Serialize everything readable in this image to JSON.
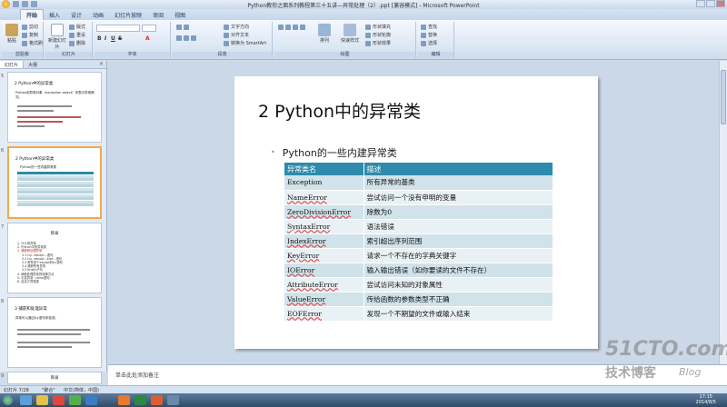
{
  "window": {
    "title": "Python教你之面系列教程第三十五讲—异常处理（2）.ppt [兼容模式] - Microsoft PowerPoint"
  },
  "ribbon": {
    "tabs": [
      "开始",
      "插入",
      "设计",
      "动画",
      "幻灯片放映",
      "审阅",
      "视图"
    ],
    "groups": {
      "clipboard": {
        "label": "剪贴板",
        "paste": "粘贴",
        "cut": "剪切",
        "copy": "复制",
        "format_painter": "格式刷"
      },
      "slides": {
        "label": "幻灯片",
        "new_slide": "新建幻灯片",
        "layout": "版式",
        "reset": "重设",
        "delete": "删除"
      },
      "font": {
        "label": "字体"
      },
      "paragraph": {
        "label": "段落",
        "text_direction": "文字方向",
        "align_text": "对齐文本",
        "convert_smartart": "转换为 SmartArt"
      },
      "drawing": {
        "label": "绘图",
        "arrange": "排列",
        "quick_styles": "快速样式",
        "shape_fill": "形状填充",
        "shape_outline": "形状轮廓",
        "shape_effects": "形状效果"
      },
      "editing": {
        "label": "编辑",
        "find": "查找",
        "replace": "替换",
        "select": "选择"
      }
    }
  },
  "left_pane": {
    "tabs": [
      "幻灯片",
      "大纲"
    ],
    "slides": [
      {
        "num": "5",
        "title": "2 Python中的异常类",
        "body": "Python用异常对象（exception object）来表示异常情况。"
      },
      {
        "num": "6",
        "title": "2 Python中的异常类",
        "body": "Python的一些内建异常类"
      },
      {
        "num": "7",
        "title": "目录",
        "items": [
          "1. 什么是异常",
          "2. Python中的异常类",
          "3. 捕获和处理异常",
          "3.1 try...except...语句",
          "3.2 try...except...else...语句",
          "3.3 带有多个except的try语句",
          "3.4 捕获所有异常",
          "3.5 finally子句",
          "4. 两种处理异常的特殊方法",
          "5. 引发异常（raise语句）",
          "6. 自定义异常类"
        ]
      },
      {
        "num": "8",
        "title": "3 捕获和处理异常",
        "body": "异常可以通过try语句来检测。"
      },
      {
        "num": "9",
        "title": "目录"
      }
    ]
  },
  "slide": {
    "title": "2 Python中的异常类",
    "bullet": "Python的一些内建异常类",
    "table": {
      "headers": [
        "异常类名",
        "描述"
      ],
      "rows": [
        [
          "Exception",
          "所有异常的基类"
        ],
        [
          "NameError",
          "尝试访问一个没有申明的变量"
        ],
        [
          "ZeroDivisionError",
          "除数为0"
        ],
        [
          "SyntaxError",
          "语法错误"
        ],
        [
          "IndexError",
          "索引超出序列范围"
        ],
        [
          "KeyError",
          "请求一个不存在的字典关键字"
        ],
        [
          "IOError",
          "输入输出错误（如你要读的文件不存在）"
        ],
        [
          "AttributeError",
          "尝试访问未知的对象属性"
        ],
        [
          "ValueError",
          "传给函数的参数类型不正确"
        ],
        [
          "EOFError",
          "发现一个不期望的文件或输入结束"
        ]
      ]
    }
  },
  "notes": {
    "placeholder": "单击此处添加备注"
  },
  "status": {
    "slide_info": "幻灯片 7/28",
    "theme": "\"聚合\"",
    "language": "中文(简体，中国)"
  },
  "watermark": {
    "line1": "51CTO.com",
    "line2": "技术博客",
    "line3": "Blog"
  },
  "taskbar": {
    "time": "17:15",
    "date": "2014/8/5"
  },
  "colors": {
    "table_header": "#2e8bab",
    "table_row_odd": "#d0e2ea",
    "table_row_even": "#e9f1f4",
    "selected_thumb_border": "#f2a94c"
  }
}
